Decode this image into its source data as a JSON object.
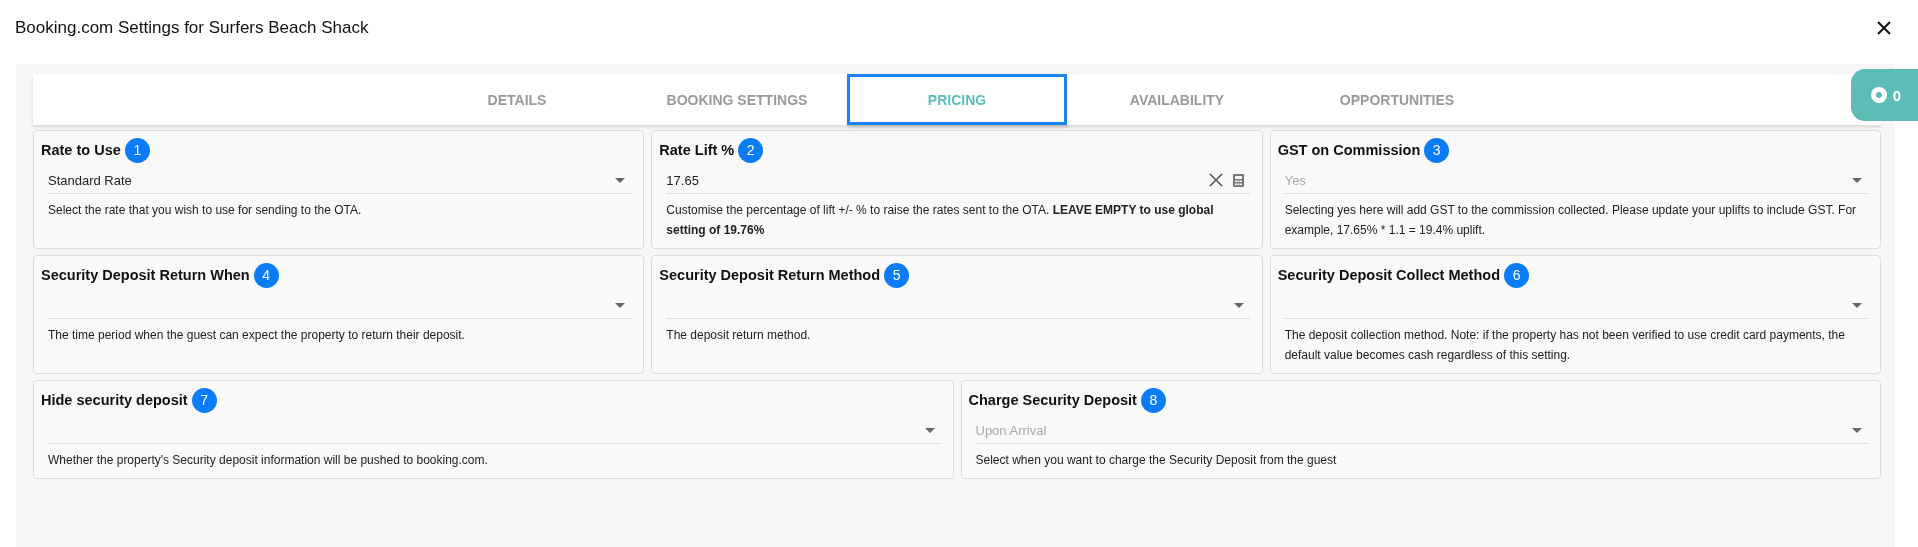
{
  "window": {
    "title": "Booking.com Settings for Surfers Beach Shack"
  },
  "tabs": [
    {
      "label": "DETAILS",
      "selected": false
    },
    {
      "label": "BOOKING SETTINGS",
      "selected": false
    },
    {
      "label": "PRICING",
      "selected": true
    },
    {
      "label": "AVAILABILITY",
      "selected": false
    },
    {
      "label": "OPPORTUNITIES",
      "selected": false
    }
  ],
  "counter_badge": {
    "count": "0"
  },
  "rows": [
    {
      "cards": [
        {
          "label": "Rate to Use",
          "step": "1",
          "field": {
            "kind": "select",
            "value": "Standard Rate",
            "disabled": false
          },
          "help": "Select the rate that you wish to use for sending to the OTA."
        },
        {
          "label": "Rate Lift %",
          "step": "2",
          "field": {
            "kind": "number",
            "value": "17.65",
            "disabled": false
          },
          "help": "Customise the percentage of lift +/- % to raise the rates sent to the OTA. **LEAVE EMPTY to use global setting of 19.76%**"
        },
        {
          "label": "GST on Commission",
          "step": "3",
          "field": {
            "kind": "select",
            "value": "Yes",
            "disabled": true
          },
          "help": "Selecting yes here will add GST to the commission collected. Please update your uplifts to include GST. For example, 17.65% * 1.1 = 19.4% uplift."
        }
      ]
    },
    {
      "cards": [
        {
          "label": "Security Deposit Return When",
          "step": "4",
          "field": {
            "kind": "select"
          },
          "help": "The time period when the guest can expect the property to return their deposit."
        },
        {
          "label": "Security Deposit Return Method",
          "step": "5",
          "field": {
            "kind": "select"
          },
          "help": "The deposit return method."
        },
        {
          "label": "Security Deposit Collect Method",
          "step": "6",
          "field": {
            "kind": "select"
          },
          "help": "The deposit collection method. Note: if the property has not been verified to use credit card payments, the default value becomes cash regardless of this setting."
        }
      ]
    },
    {
      "cards": [
        {
          "label": "Hide security deposit",
          "step": "7",
          "field": {
            "kind": "select"
          },
          "help": "Whether the property's Security deposit information will be pushed to booking.com."
        },
        {
          "label": "Charge Security Deposit",
          "step": "8",
          "field": {
            "kind": "select",
            "value": "Upon Arrival",
            "disabled": true
          },
          "help": "Select when you want to charge the Security Deposit from the guest"
        }
      ]
    }
  ]
}
